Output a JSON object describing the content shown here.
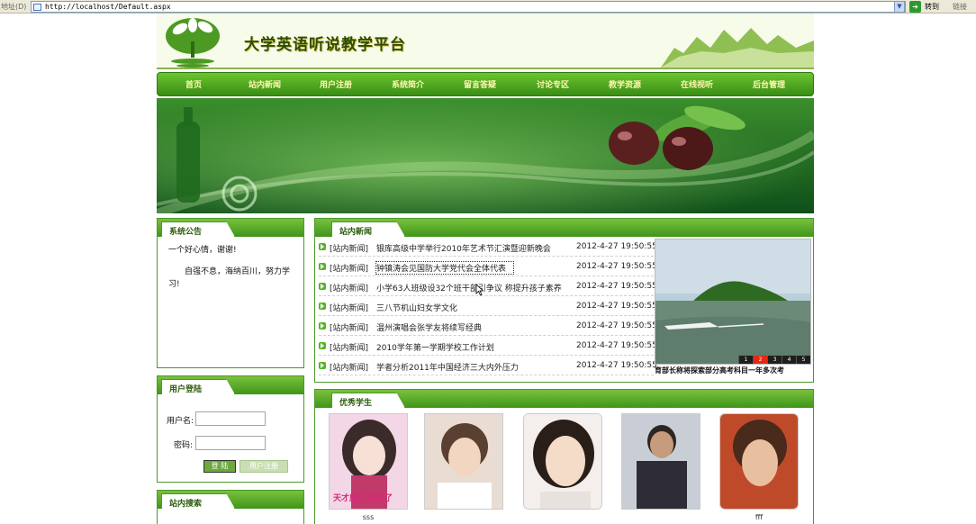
{
  "browser": {
    "address_label": "地址(D)",
    "url": "http://localhost/Default.aspx",
    "go_label": "转到",
    "links_label": "链接"
  },
  "site": {
    "title": "大学英语听说教学平台"
  },
  "nav": [
    "首页",
    "站内新闻",
    "用户注册",
    "系统简介",
    "留言答疑",
    "讨论专区",
    "教学资源",
    "在线视听",
    "后台管理"
  ],
  "notice": {
    "title": "系统公告",
    "line1": "一个好心情，谢谢!",
    "line2": "自强不息，海纳百川，努力学习!"
  },
  "login": {
    "title": "用户登陆",
    "username_label": "用户名:",
    "password_label": "密码:",
    "login_button": "登 陆",
    "register_button": "用户注册"
  },
  "search": {
    "title": "站内搜索"
  },
  "news": {
    "title": "站内新闻",
    "items": [
      {
        "cat": "[站内新闻]",
        "title": "银库高级中学举行2010年艺术节汇演暨迎新晚会",
        "date": "2012-4-27 19:50:55"
      },
      {
        "cat": "[站内新闻]",
        "title": "钟镇涛会见国防大学党代会全体代表",
        "date": "2012-4-27 19:50:55"
      },
      {
        "cat": "[站内新闻]",
        "title": "小学63人班级设32个班干部引争议 称提升孩子素养",
        "date": "2012-4-27 19:50:55"
      },
      {
        "cat": "[站内新闻]",
        "title": "三八节机山妇女学文化",
        "date": "2012-4-27 19:50:55"
      },
      {
        "cat": "[站内新闻]",
        "title": "温州演唱会张学友将续写经典",
        "date": "2012-4-27 19:50:55"
      },
      {
        "cat": "[站内新闻]",
        "title": "2010学年第一学期学校工作计划",
        "date": "2012-4-27 19:50:55"
      },
      {
        "cat": "[站内新闻]",
        "title": "学者分析2011年中国经济三大内外压力",
        "date": "2012-4-27 19:50:55"
      }
    ],
    "slider_pages": [
      "1",
      "2",
      "3",
      "4",
      "5"
    ],
    "slider_caption": "育部长称将探索部分高考科目一年多次考"
  },
  "students": {
    "title": "优秀学生",
    "photo1_text": "天才魔法 我要了",
    "captions": [
      "sss",
      "",
      "",
      "",
      "fff"
    ]
  }
}
